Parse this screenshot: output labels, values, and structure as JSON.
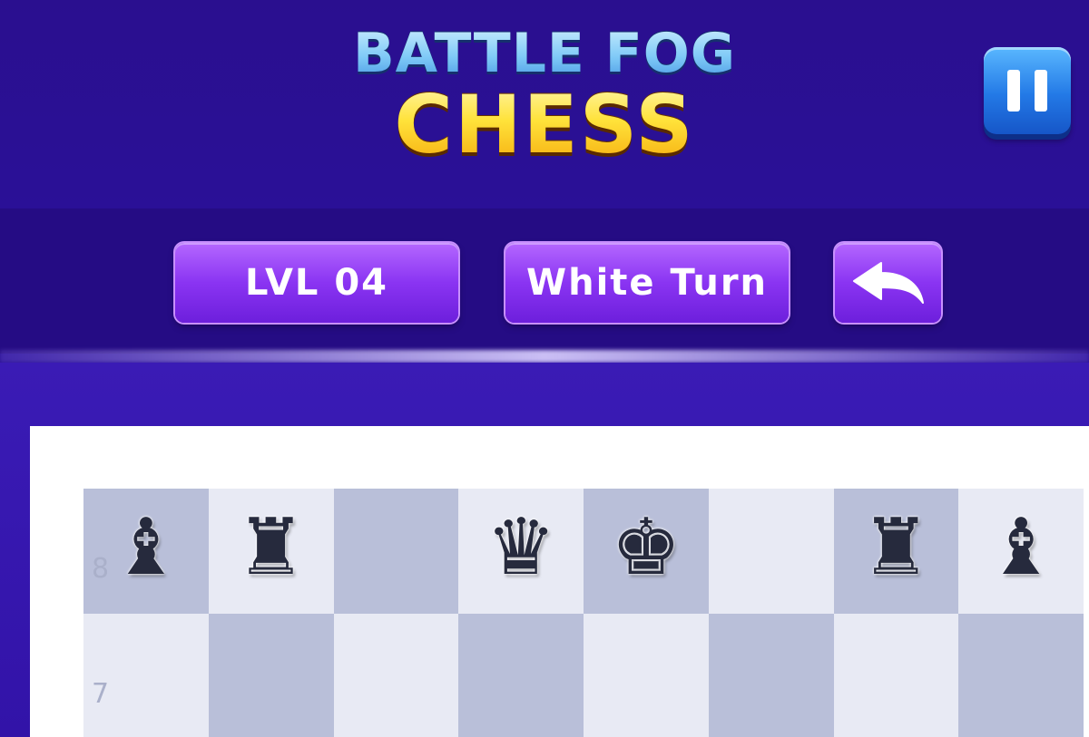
{
  "header": {
    "title_line1": "BATTLE FOG",
    "title_line2": "CHESS"
  },
  "controls": {
    "level": "LVL 04",
    "turn": "White Turn",
    "pause_icon": "pause-icon",
    "undo_icon": "undo-arrow-icon"
  },
  "board": {
    "rank_labels": [
      "8",
      "7"
    ],
    "rank8": [
      "♝",
      "♜",
      "",
      "♛",
      "♚",
      "",
      "♜",
      "♝"
    ],
    "rank7": [
      "",
      "",
      "",
      "",
      "",
      "",
      "",
      ""
    ]
  },
  "colors": {
    "background": "#2a1196",
    "chip_purple": "#8a34f2",
    "pause_blue": "#2379e6",
    "square_light": "#e8eaf4",
    "square_dark": "#b9bfd9",
    "piece_dark": "#262a3d"
  }
}
